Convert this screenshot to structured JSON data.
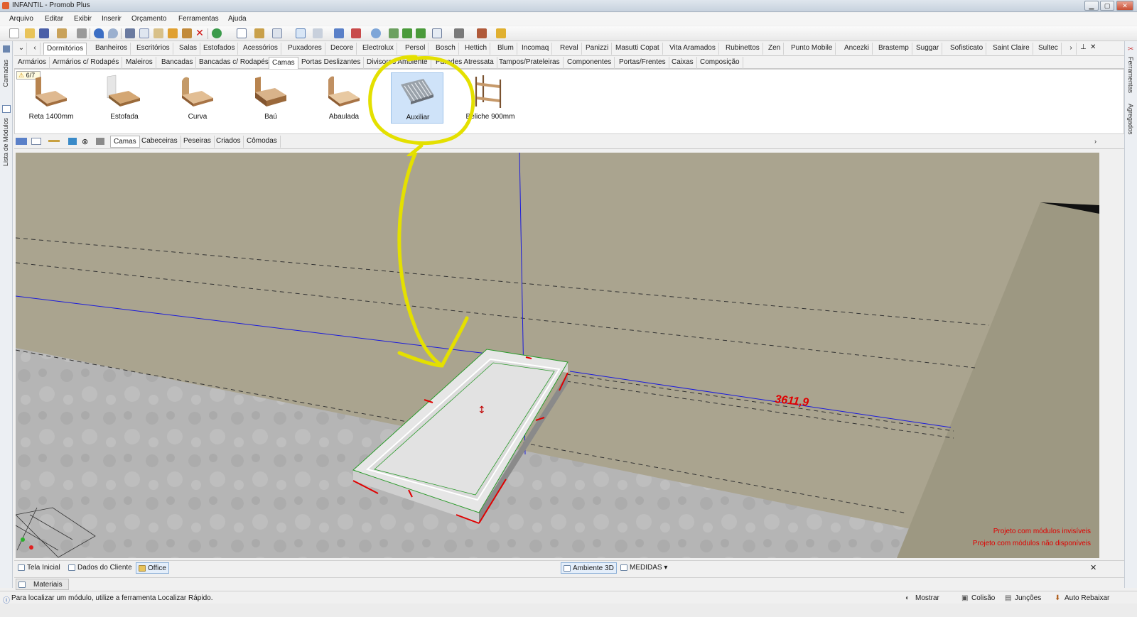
{
  "window": {
    "title": "INFANTIL - Promob Plus",
    "minimize": "▁",
    "maximize": "▢",
    "close": "✕"
  },
  "menu": [
    "Arquivo",
    "Editar",
    "Exibir",
    "Inserir",
    "Orçamento",
    "Ferramentas",
    "Ajuda"
  ],
  "left_dock": {
    "camadas": "Camadas",
    "lista_modulos": "Lista de Módulos"
  },
  "right_dock": {
    "ferramentas": "Ferramentas",
    "agregados": "Agregados"
  },
  "category_tabs": [
    "Dormitórios",
    "Banheiros",
    "Escritórios",
    "Salas",
    "Estofados",
    "Acessórios",
    "Puxadores",
    "Decore",
    "Electrolux",
    "Persol",
    "Bosch",
    "Hettich",
    "Blum",
    "Incomaq",
    "Reval",
    "Panizzi",
    "Masutti Copat",
    "Vita Aramados",
    "Rubinettos",
    "Zen",
    "Punto Mobile",
    "Ancezki",
    "Brastemp",
    "Suggar",
    "Sofisticato",
    "Saint Claire",
    "Sultec"
  ],
  "category_active": "Dormitórios",
  "subcategory_tabs": [
    "Armários",
    "Armários c/ Rodapés",
    "Maleiros",
    "Bancadas",
    "Bancadas c/ Rodapés",
    "Camas",
    "Portas Deslizantes",
    "Divisores Ambiente",
    "Paredes Atressata",
    "Tampos/Prateleiras",
    "Componentes",
    "Portas/Frentes",
    "Caixas",
    "Composição"
  ],
  "subcategory_active": "Camas",
  "library": {
    "warning_count": "6/7",
    "items": [
      {
        "label": "Reta 1400mm",
        "icon": "bed-icon"
      },
      {
        "label": "Estofada",
        "icon": "upholstered-bed-icon"
      },
      {
        "label": "Curva",
        "icon": "curved-bed-icon"
      },
      {
        "label": "Baú",
        "icon": "storage-bed-icon"
      },
      {
        "label": "Abaulada",
        "icon": "rounded-bed-icon"
      },
      {
        "label": "Auxiliar",
        "icon": "auxiliary-bed-icon"
      },
      {
        "label": "Beliche 900mm",
        "icon": "bunk-bed-icon"
      }
    ],
    "selected": "Auxiliar"
  },
  "module_tabs": [
    "Camas",
    "Cabeceiras",
    "Peseiras",
    "Criados",
    "Cômodas"
  ],
  "module_active": "Camas",
  "viewport": {
    "dimension_label": "3611,9",
    "messages": [
      "Projeto com módulos invisíveis",
      "Projeto com módulos não disponíveis"
    ]
  },
  "bottom_tabs": {
    "left": [
      "Tela Inicial",
      "Dados do Cliente",
      "Office"
    ],
    "active": "Office",
    "ambiente": "Ambiente 3D",
    "medidas": "MEDIDAS",
    "close": "✕"
  },
  "materials_tab": "Materiais",
  "status": {
    "hint": "Para localizar um módulo, utilize a ferramenta Localizar Rápido.",
    "mostrar": "Mostrar",
    "colisao": "Colisão",
    "juncoes": "Junções",
    "auto_rebaixar": "Auto Rebaixar"
  },
  "colors": {
    "annotation": "#e4e000",
    "dimension": "#e00000",
    "guide_line": "#1a1adc"
  }
}
